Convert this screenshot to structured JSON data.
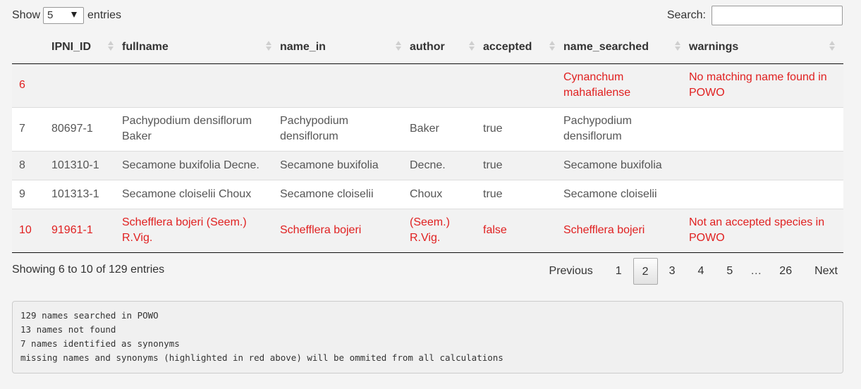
{
  "controls": {
    "show_label": "Show",
    "length_value": "5",
    "entries_label": "entries",
    "search_label": "Search:",
    "search_value": ""
  },
  "columns": [
    "",
    "IPNI_ID",
    "fullname",
    "name_in",
    "author",
    "accepted",
    "name_searched",
    "warnings"
  ],
  "rows": [
    {
      "idx": "6",
      "ipni_id": "",
      "fullname": "",
      "name_in": "",
      "author": "",
      "accepted": "",
      "name_searched": "Cynanchum mahafialense",
      "warnings": "No matching name found in POWO",
      "highlight": true
    },
    {
      "idx": "7",
      "ipni_id": "80697-1",
      "fullname": "Pachypodium densiflorum Baker",
      "name_in": "Pachypodium densiflorum",
      "author": "Baker",
      "accepted": "true",
      "name_searched": "Pachypodium densiflorum",
      "warnings": "",
      "highlight": false
    },
    {
      "idx": "8",
      "ipni_id": "101310-1",
      "fullname": "Secamone buxifolia Decne.",
      "name_in": "Secamone buxifolia",
      "author": "Decne.",
      "accepted": "true",
      "name_searched": "Secamone buxifolia",
      "warnings": "",
      "highlight": false
    },
    {
      "idx": "9",
      "ipni_id": "101313-1",
      "fullname": "Secamone cloiselii Choux",
      "name_in": "Secamone cloiselii",
      "author": "Choux",
      "accepted": "true",
      "name_searched": "Secamone cloiselii",
      "warnings": "",
      "highlight": false
    },
    {
      "idx": "10",
      "ipni_id": "91961-1",
      "fullname": "Schefflera bojeri (Seem.) R.Vig.",
      "name_in": "Schefflera bojeri",
      "author": "(Seem.) R.Vig.",
      "accepted": "false",
      "name_searched": "Schefflera bojeri",
      "warnings": "Not an accepted species in POWO",
      "highlight": true
    }
  ],
  "info": "Showing 6 to 10 of 129 entries",
  "pagination": {
    "previous": "Previous",
    "pages": [
      "1",
      "2",
      "3",
      "4",
      "5"
    ],
    "current": "2",
    "ellipsis": "…",
    "last": "26",
    "next": "Next"
  },
  "console": [
    "129 names searched in POWO",
    "13 names not found",
    "7 names identified as synonyms",
    "missing names and synonyms (highlighted in red above) will be ommited from all calculations"
  ],
  "colors": {
    "highlight_text": "#e02020",
    "striped_row": "#f2f2f2"
  }
}
